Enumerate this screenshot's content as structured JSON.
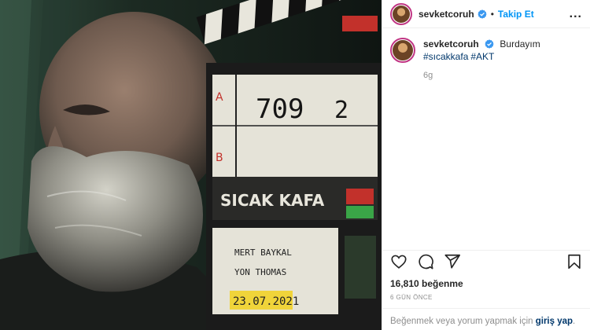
{
  "post": {
    "username": "sevketcoruh",
    "follow_label": "Takip Et",
    "more_label": "...",
    "dot": "•"
  },
  "caption": {
    "username": "sevketcoruh",
    "text": "Burdayım",
    "hashtags": [
      "#sıcakkafa",
      "#AKT"
    ],
    "age": "6g"
  },
  "photo": {
    "clapper": {
      "roll": "709",
      "slate": "2",
      "title": "SICAK KAFA",
      "director": "MERT BAYKAL",
      "dop": "YON THOMAS",
      "date": "23.07.2021",
      "scene_a": "A",
      "scene_b": "B"
    }
  },
  "actions": {
    "like_icon": "heart-icon",
    "comment_icon": "comment-icon",
    "share_icon": "share-icon",
    "save_icon": "bookmark-icon"
  },
  "likes": "16,810 beğenme",
  "date": "6 GÜN ÖNCE",
  "login": {
    "prefix": "Beğenmek veya yorum yapmak için ",
    "link": "giriş yap",
    "suffix": "."
  },
  "colors": {
    "accent": "#0095f6",
    "verified": "#3897f0",
    "hashtag": "#00376b",
    "muted": "#8e8e8e"
  }
}
